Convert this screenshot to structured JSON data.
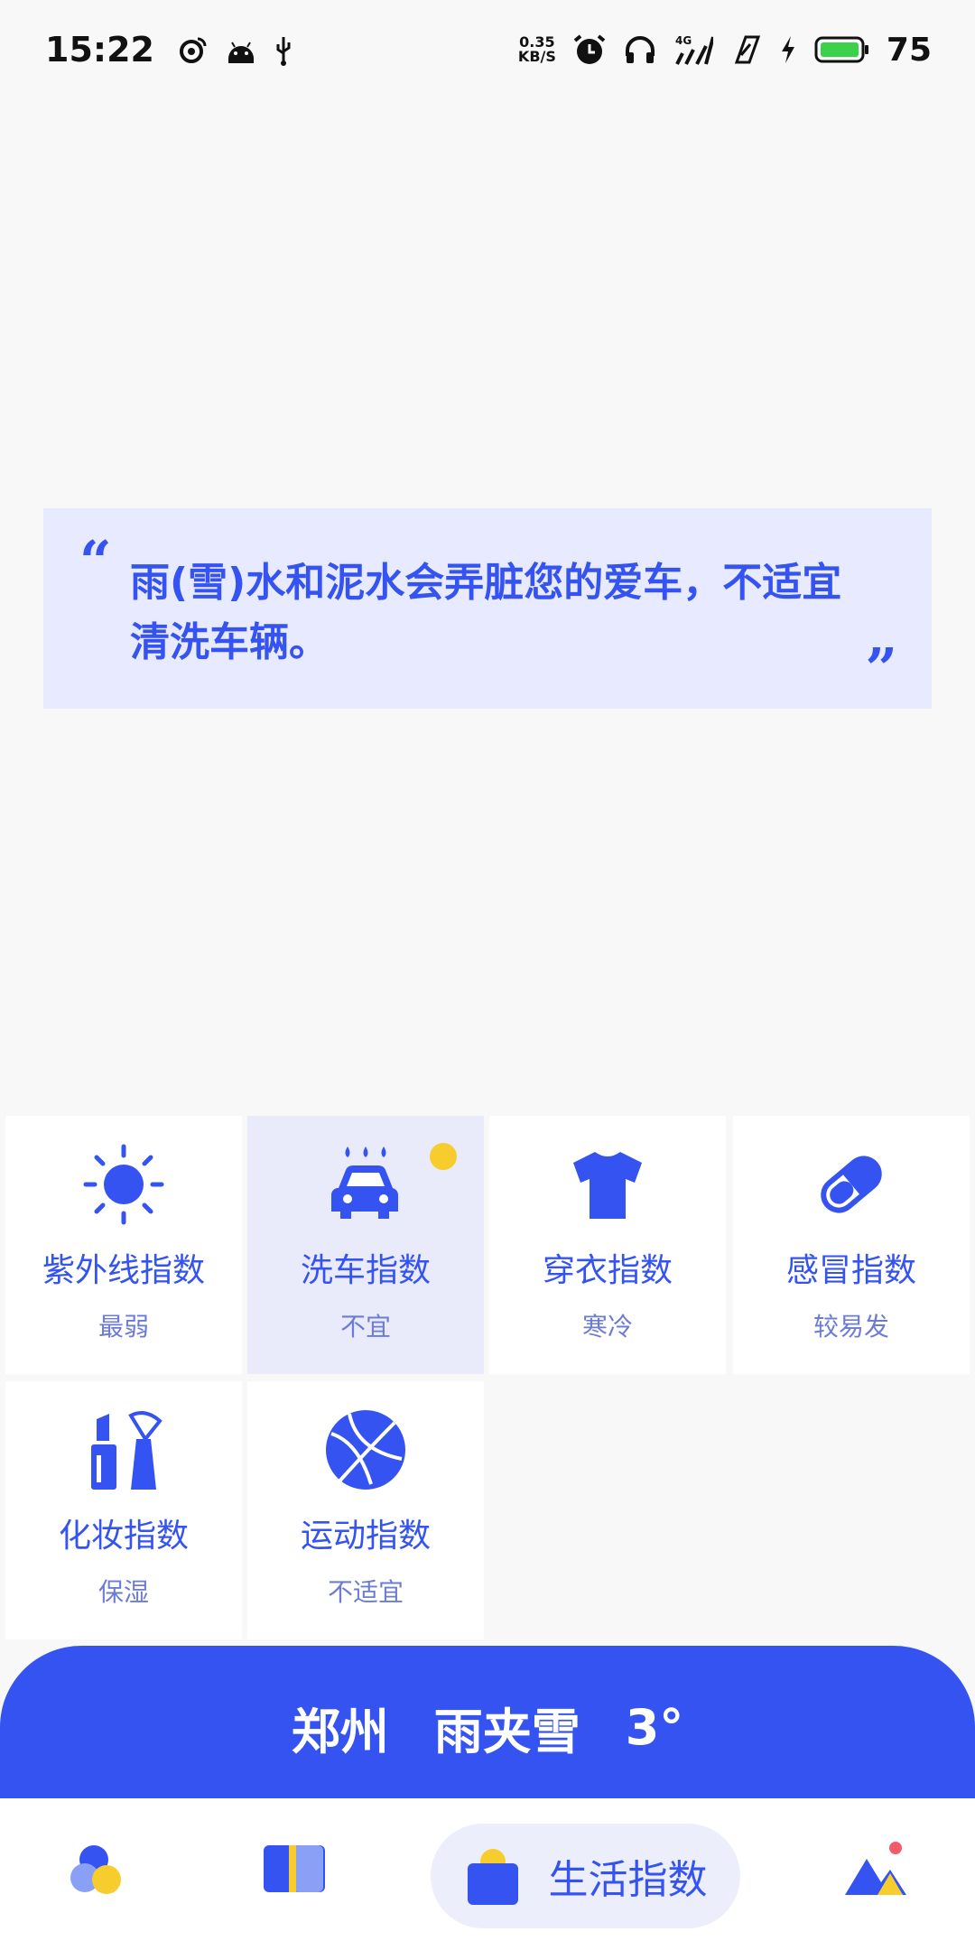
{
  "status_bar": {
    "time": "15:22",
    "net_speed_value": "0.35",
    "net_speed_unit": "KB/S",
    "network": "4G",
    "battery": "75",
    "icons": [
      "weibo-icon",
      "android-icon",
      "usb-icon",
      "alarm-icon",
      "headphones-icon",
      "signal-icon",
      "signal-hd-icon",
      "charging-icon",
      "battery-icon"
    ]
  },
  "quote": {
    "open_mark": "“",
    "close_mark": "”",
    "text": "雨(雪)水和泥水会弄脏您的爱车，不适宜清洗车辆。"
  },
  "indices": [
    {
      "name": "紫外线指数",
      "value": "最弱",
      "icon": "sun-icon",
      "active": false
    },
    {
      "name": "洗车指数",
      "value": "不宜",
      "icon": "car-wash-icon",
      "active": true
    },
    {
      "name": "穿衣指数",
      "value": "寒冷",
      "icon": "tshirt-icon",
      "active": false
    },
    {
      "name": "感冒指数",
      "value": "较易发",
      "icon": "pill-icon",
      "active": false
    },
    {
      "name": "化妆指数",
      "value": "保湿",
      "icon": "makeup-icon",
      "active": false
    },
    {
      "name": "运动指数",
      "value": "不适宜",
      "icon": "basketball-icon",
      "active": false
    }
  ],
  "weather": {
    "city": "郑州",
    "condition": "雨夹雪",
    "temperature": "3°"
  },
  "nav": {
    "active_label": "生活指数",
    "items": [
      "circles-icon",
      "cards-icon",
      "bag-icon",
      "mountain-icon"
    ]
  },
  "colors": {
    "accent": "#3453f0",
    "highlight": "#f7cd2d",
    "card_bg": "#e8eaff"
  }
}
